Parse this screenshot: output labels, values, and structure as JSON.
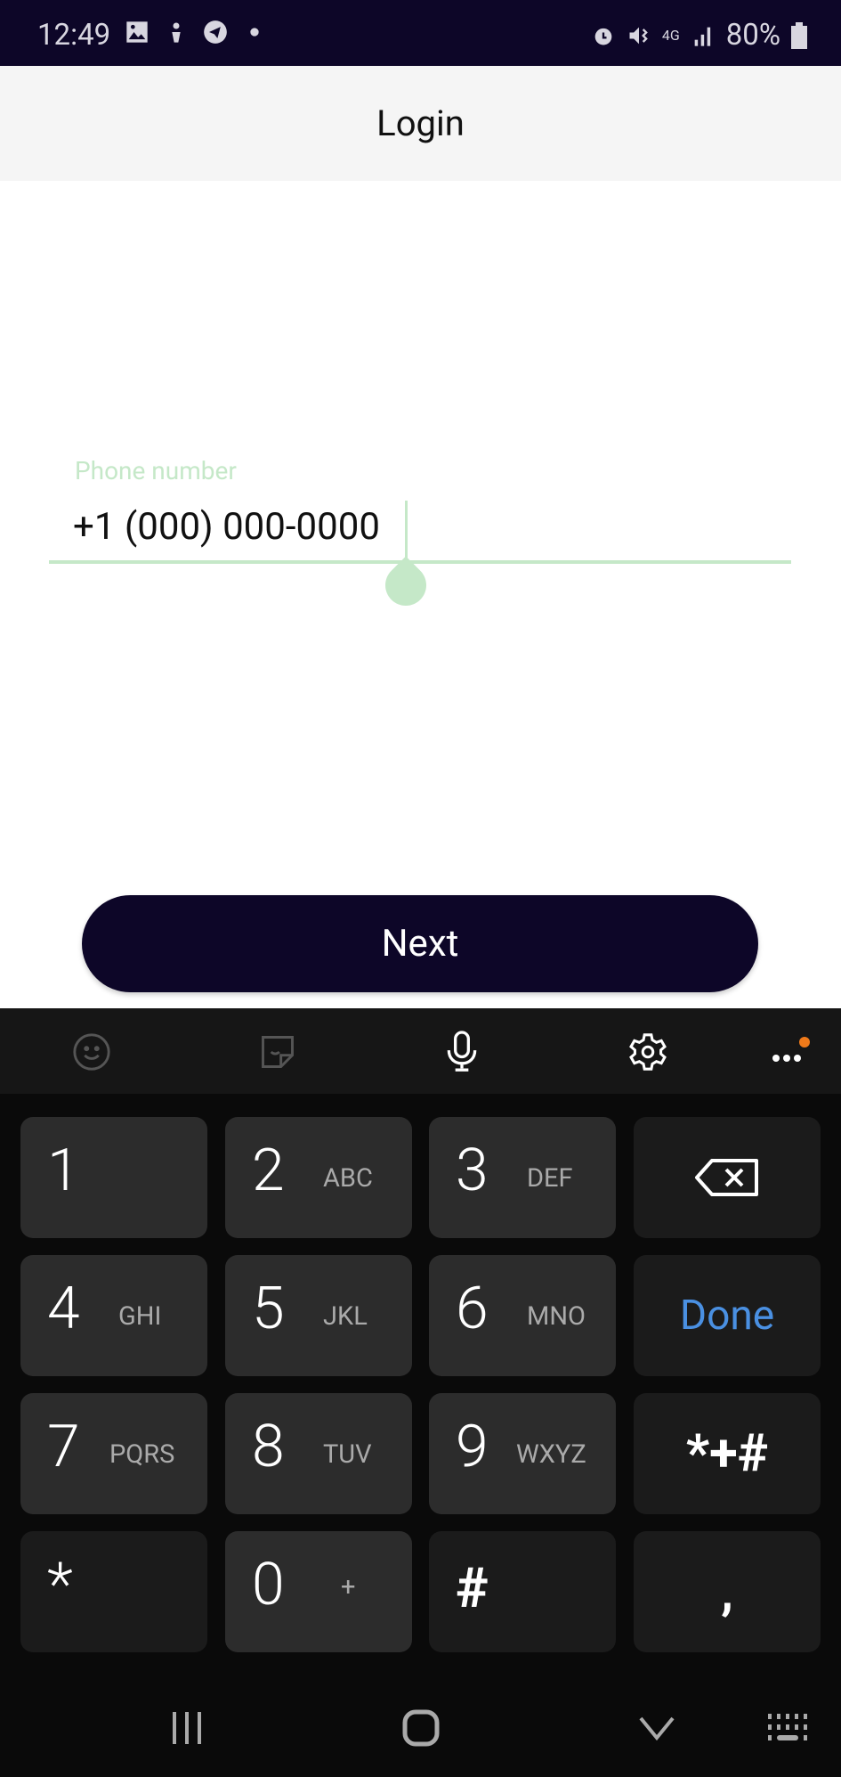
{
  "status_bar": {
    "time": "12:49",
    "battery": "80%",
    "network": "4G",
    "icons": [
      "gallery-icon",
      "notification-icon",
      "telegram-icon",
      "dot-icon",
      "alarm-icon",
      "vibrate-icon",
      "4g-icon",
      "signal-icon",
      "battery-icon"
    ]
  },
  "header": {
    "title": "Login"
  },
  "form": {
    "phone_label": "Phone number",
    "phone_value": "+1 (000) 000-0000",
    "accent": "#c5e8c8"
  },
  "next_button": {
    "label": "Next",
    "color": "#0d0628"
  },
  "keyboard": {
    "toolbar": [
      "emoji-icon",
      "sticker-icon",
      "microphone-icon",
      "settings-icon",
      "more-icon"
    ],
    "keys": [
      {
        "digit": "1",
        "letters": ""
      },
      {
        "digit": "2",
        "letters": "ABC"
      },
      {
        "digit": "3",
        "letters": "DEF"
      },
      {
        "digit": "4",
        "letters": "GHI"
      },
      {
        "digit": "5",
        "letters": "JKL"
      },
      {
        "digit": "6",
        "letters": "MNO"
      },
      {
        "digit": "7",
        "letters": "PQRS"
      },
      {
        "digit": "8",
        "letters": "TUV"
      },
      {
        "digit": "9",
        "letters": "WXYZ"
      },
      {
        "digit": "0",
        "letters": "+"
      }
    ],
    "star": "*",
    "hash": "#",
    "comma": ",",
    "done": "Done",
    "symbols": "*+#",
    "done_color": "#4a90e2"
  },
  "nav_bar": [
    "recents-icon",
    "home-icon",
    "hide-keyboard-icon",
    "keyboard-switch-icon"
  ]
}
